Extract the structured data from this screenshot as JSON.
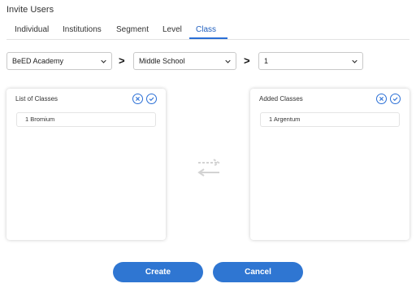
{
  "header": {
    "title": "Invite Users"
  },
  "tabs": [
    {
      "label": "Individual"
    },
    {
      "label": "Institutions"
    },
    {
      "label": "Segment"
    },
    {
      "label": "Level"
    },
    {
      "label": "Class"
    }
  ],
  "active_tab": "Class",
  "filters": {
    "school": "BeED Academy",
    "level": "Middle School",
    "grade": "1",
    "separator": ">"
  },
  "left_panel": {
    "title": "List of Classes",
    "items": [
      "1 Bromium"
    ]
  },
  "right_panel": {
    "title": "Added Classes",
    "items": [
      "1 Argentum"
    ]
  },
  "icons": {
    "clear": "close-icon",
    "confirm": "check-icon",
    "dropdown": "chevron-down-icon",
    "transfer": "transfer-arrows-icon"
  },
  "colors": {
    "accent": "#2a6fd6",
    "button_bg": "#2f76d2",
    "transfer_arrows": "#d3d3d3"
  },
  "footer": {
    "create_label": "Create",
    "cancel_label": "Cancel"
  }
}
